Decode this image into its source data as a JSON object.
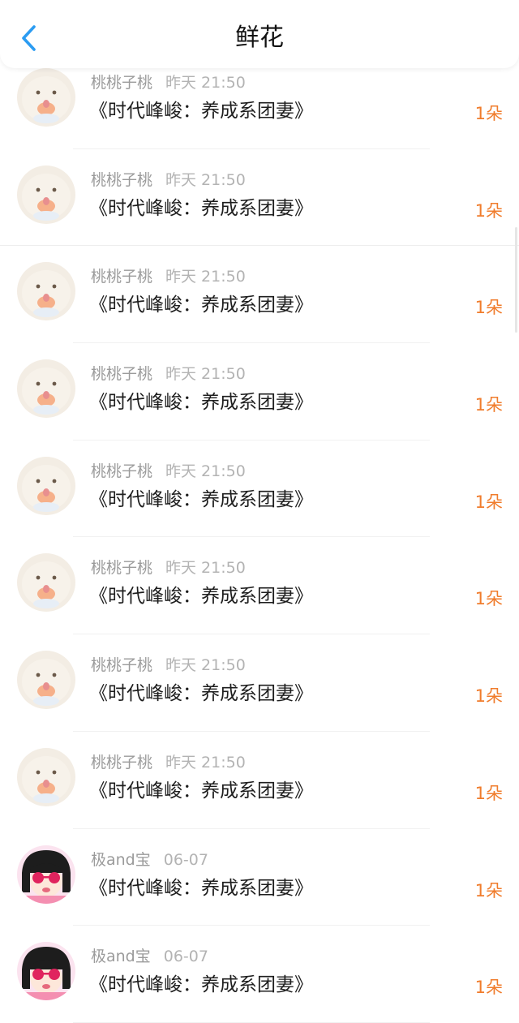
{
  "header": {
    "title": "鲜花",
    "back_icon": "chevron-left-icon",
    "accent": "#2b9cf2"
  },
  "colors": {
    "amount": "#f07c2c"
  },
  "items": [
    {
      "user": "桃桃子桃",
      "time": "昨天 21:50",
      "work": "《时代峰峻：养成系团妻》",
      "amount": "1朵",
      "avatar": "cat-avatar"
    },
    {
      "user": "桃桃子桃",
      "time": "昨天 21:50",
      "work": "《时代峰峻：养成系团妻》",
      "amount": "1朵",
      "avatar": "cat-avatar"
    },
    {
      "user": "桃桃子桃",
      "time": "昨天 21:50",
      "work": "《时代峰峻：养成系团妻》",
      "amount": "1朵",
      "avatar": "cat-avatar"
    },
    {
      "user": "桃桃子桃",
      "time": "昨天 21:50",
      "work": "《时代峰峻：养成系团妻》",
      "amount": "1朵",
      "avatar": "cat-avatar"
    },
    {
      "user": "桃桃子桃",
      "time": "昨天 21:50",
      "work": "《时代峰峻：养成系团妻》",
      "amount": "1朵",
      "avatar": "cat-avatar"
    },
    {
      "user": "桃桃子桃",
      "time": "昨天 21:50",
      "work": "《时代峰峻：养成系团妻》",
      "amount": "1朵",
      "avatar": "cat-avatar"
    },
    {
      "user": "桃桃子桃",
      "time": "昨天 21:50",
      "work": "《时代峰峻：养成系团妻》",
      "amount": "1朵",
      "avatar": "cat-avatar"
    },
    {
      "user": "桃桃子桃",
      "time": "昨天 21:50",
      "work": "《时代峰峻：养成系团妻》",
      "amount": "1朵",
      "avatar": "cat-avatar"
    },
    {
      "user": "极and宝",
      "time": "06-07",
      "work": "《时代峰峻：养成系团妻》",
      "amount": "1朵",
      "avatar": "cartoon-girl-avatar"
    },
    {
      "user": "极and宝",
      "time": "06-07",
      "work": "《时代峰峻：养成系团妻》",
      "amount": "1朵",
      "avatar": "cartoon-girl-avatar"
    }
  ]
}
